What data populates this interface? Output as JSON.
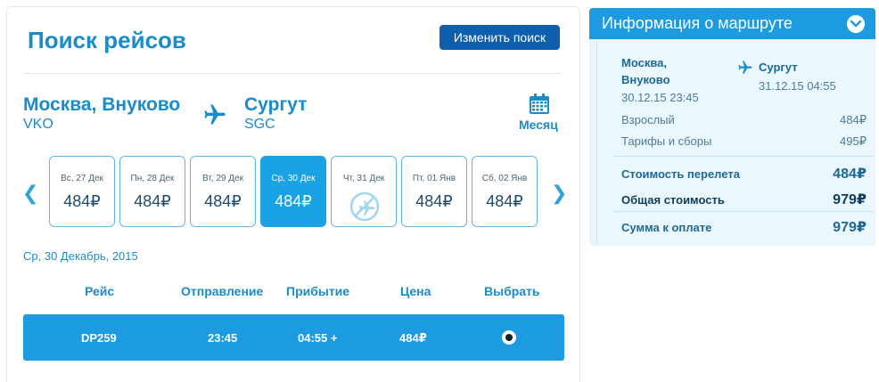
{
  "search": {
    "title": "Поиск рейсов",
    "change_label": "Изменить поиск",
    "from_city": "Москва, Внуково",
    "from_code": "VKO",
    "to_city": "Сургут",
    "to_code": "SGC",
    "month_label": "Месяц"
  },
  "days": [
    {
      "label": "Вс, 27 Дек",
      "price": "484₽",
      "selected": false,
      "available": true
    },
    {
      "label": "Пн, 28 Дек",
      "price": "484₽",
      "selected": false,
      "available": true
    },
    {
      "label": "Вт, 29 Дек",
      "price": "484₽",
      "selected": false,
      "available": true
    },
    {
      "label": "Ср, 30 Дек",
      "price": "484₽",
      "selected": true,
      "available": true
    },
    {
      "label": "Чт, 31 Дек",
      "price": "",
      "selected": false,
      "available": false
    },
    {
      "label": "Пт, 01 Янв",
      "price": "484₽",
      "selected": false,
      "available": true
    },
    {
      "label": "Сб, 02 Янв",
      "price": "484₽",
      "selected": false,
      "available": true
    }
  ],
  "selected_date": "Ср, 30 Декабрь, 2015",
  "table": {
    "headers": [
      "Рейс",
      "Отправление",
      "Прибытие",
      "Цена",
      "Выбрать"
    ],
    "rows": [
      {
        "flight": "DP259",
        "departure": "23:45",
        "arrival": "04:55 +",
        "price": "484₽",
        "selected": true
      }
    ]
  },
  "route_info": {
    "title": "Информация о маршруте",
    "from_city": "Москва, Внуково",
    "from_datetime": "30.12.15 23:45",
    "to_city": "Сургут",
    "to_datetime": "31.12.15 04:55",
    "adult_label": "Взрослый",
    "adult_value": "484₽",
    "fees_label": "Тарифы и сборы",
    "fees_value": "495₽",
    "flight_cost_label": "Стоимость перелета",
    "flight_cost_value": "484₽",
    "total_label": "Общая стоимость",
    "total_value": "979₽",
    "pay_label": "Сумма к оплате",
    "pay_value": "979₽"
  },
  "colors": {
    "accent": "#1a8cc9",
    "selected_day": "#19a2e4",
    "flight_row": "#1c9be0",
    "button": "#0e5fae"
  }
}
